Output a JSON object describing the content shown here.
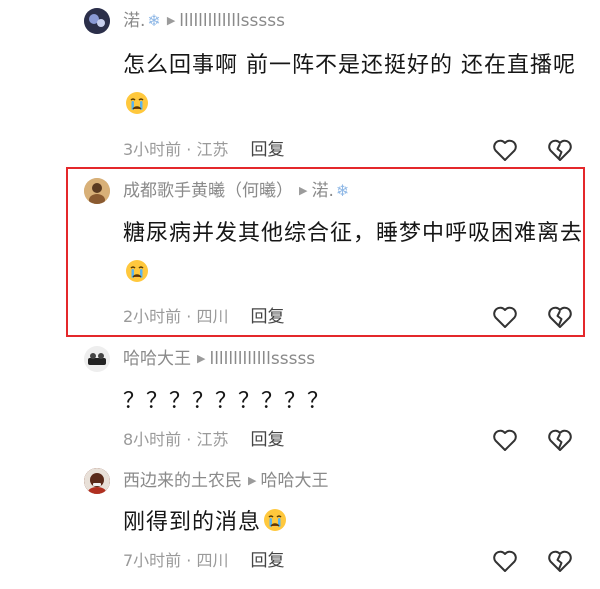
{
  "comments": [
    {
      "author": "渃.",
      "reply_to": "lllllllllllllsssss",
      "text": "怎么回事啊  前一阵不是还挺好的  还在直播呢",
      "emoji": "crying-face",
      "time_location": "3小时前 · 江苏",
      "reply_label": "回复"
    },
    {
      "author": "成都歌手黄曦（何曦）",
      "reply_to": "渃.",
      "text": "糖尿病并发其他综合征，睡梦中呼吸困难离去",
      "emoji": "crying-face",
      "time_location": "2小时前 · 四川",
      "reply_label": "回复"
    },
    {
      "author": "哈哈大王",
      "reply_to": "lllllllllllllsssss",
      "text": "？？？？？？？？？",
      "emoji": "",
      "time_location": "8小时前 · 江苏",
      "reply_label": "回复"
    },
    {
      "author": "西边来的土农民",
      "reply_to": "哈哈大王",
      "text": "刚得到的消息",
      "emoji": "crying-face",
      "time_location": "7小时前 · 四川",
      "reply_label": "回复"
    }
  ],
  "colors": {
    "highlight_border": "#e4282b",
    "secondary_text": "#8a8a8a",
    "primary_text": "#161616"
  },
  "icons": [
    "heart-outline-icon",
    "broken-heart-outline-icon",
    "snowflake-icon",
    "caret-right-icon",
    "crying-face-emoji"
  ]
}
